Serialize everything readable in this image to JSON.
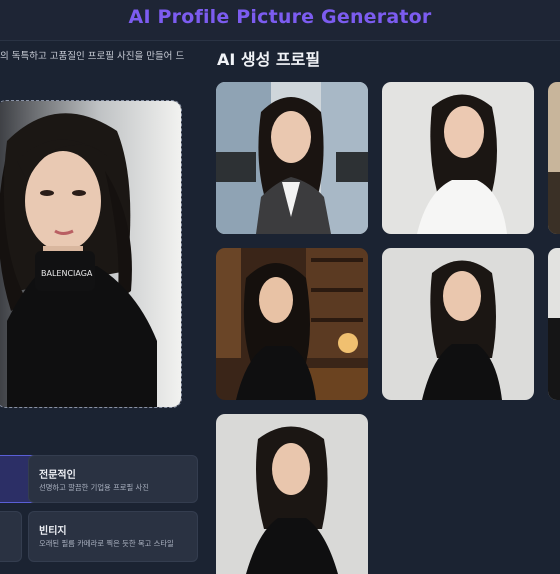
{
  "app": {
    "title": "AI Profile Picture Generator"
  },
  "upload": {
    "description": "의 독특하고 고품질인 프로필 사진을 만들어 드"
  },
  "results": {
    "title": "AI 생성 프로필",
    "images": [
      {
        "scene": "office-blazer"
      },
      {
        "scene": "white-top"
      },
      {
        "scene": "library-study"
      },
      {
        "scene": "black-turtleneck-white-bg"
      },
      {
        "scene": "grey-backdrop-turtleneck"
      },
      {
        "scene": "partial-right-1"
      },
      {
        "scene": "partial-right-2"
      }
    ]
  },
  "upload_photo": {
    "logo_text": "BALENCIAGA"
  },
  "styles": [
    {
      "title": "전문적인",
      "description": "선명하고 깔끔한 기업용 프로필 사진",
      "selected": false
    },
    {
      "title": "빈티지",
      "description": "오래된 필름 카메라로 찍은 듯한 복고 스타일",
      "selected": false
    },
    {
      "title": "",
      "description": "",
      "selected": true
    },
    {
      "title": "",
      "description": "",
      "selected": false
    }
  ],
  "colors": {
    "background": "#1b2332",
    "accent": "#7c5cf0",
    "card": "#2a3242",
    "card_selected": "#2c2f66"
  }
}
